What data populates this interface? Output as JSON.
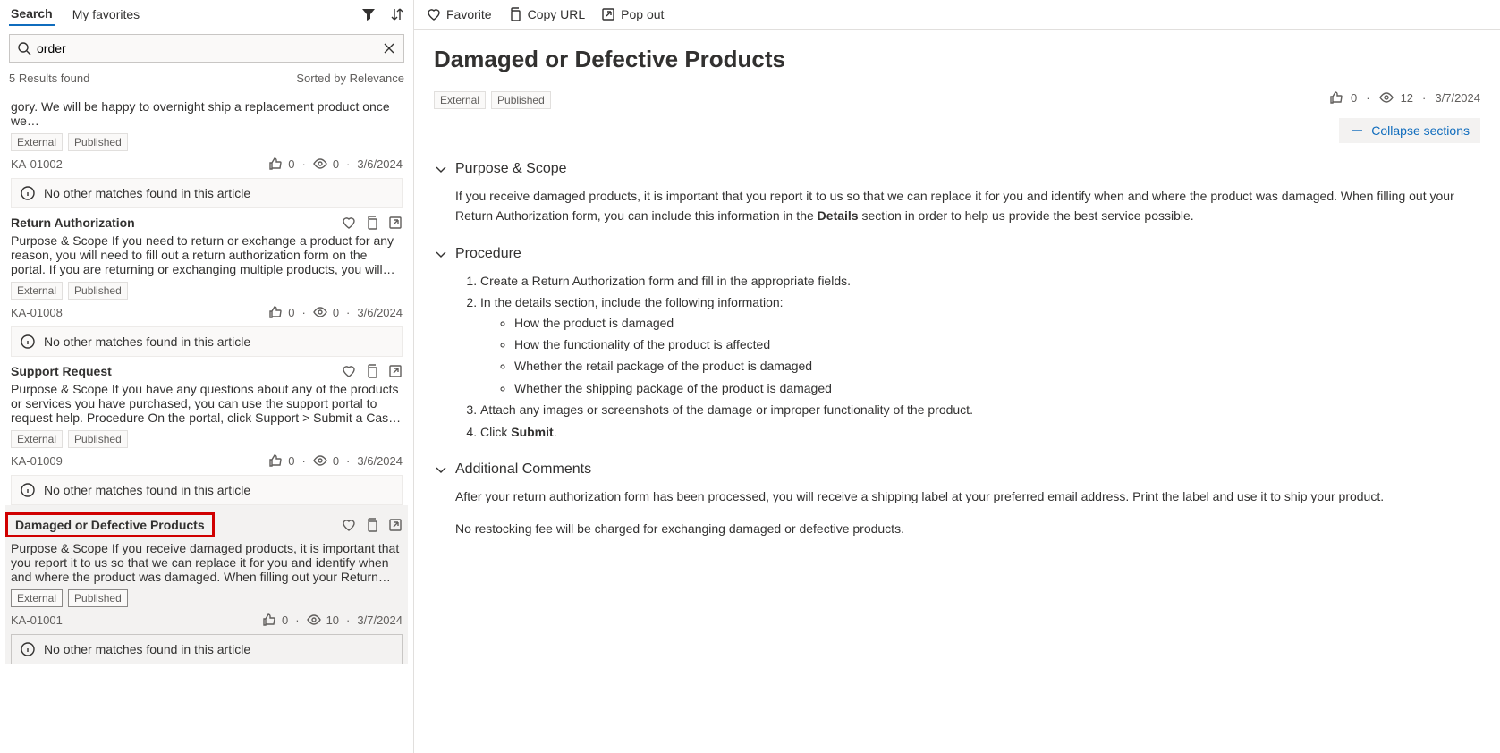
{
  "leftPanel": {
    "tabs": {
      "search": "Search",
      "favorites": "My favorites"
    },
    "searchValue": "order",
    "resultsCountText": "5 Results found",
    "sortedByText": "Sorted by Relevance",
    "results": [
      {
        "title": "",
        "snippet": "gory. We will be happy to overnight ship a replacement product once we…",
        "badges": [
          "External",
          "Published"
        ],
        "id": "KA-01002",
        "likes": "0",
        "views": "0",
        "date": "3/6/2024",
        "noMatch": "No other matches found in this article",
        "selected": false,
        "highlighted": false,
        "showTitle": false
      },
      {
        "title": "Return Authorization",
        "snippet": "Purpose & Scope If you need to return or exchange a product for any reason, you will need to fill out a return authorization form on the portal. If you are returning or exchanging multiple products, you will need to fill out…",
        "badges": [
          "External",
          "Published"
        ],
        "id": "KA-01008",
        "likes": "0",
        "views": "0",
        "date": "3/6/2024",
        "noMatch": "No other matches found in this article",
        "selected": false,
        "highlighted": false,
        "showTitle": true
      },
      {
        "title": "Support Request",
        "snippet": "Purpose & Scope If you have any questions about any of the products or services you have purchased, you can use the support portal to request help. Procedure On the portal, click Support > Submit a Case. Fill in your n…",
        "badges": [
          "External",
          "Published"
        ],
        "id": "KA-01009",
        "likes": "0",
        "views": "0",
        "date": "3/6/2024",
        "noMatch": "No other matches found in this article",
        "selected": false,
        "highlighted": false,
        "showTitle": true
      },
      {
        "title": "Damaged or Defective Products",
        "snippet": "Purpose & Scope If you receive damaged products, it is important that you report it to us so that we can replace it for you and identify when and where the product was damaged. When filling out your Return Authorizat…",
        "badges": [
          "External",
          "Published"
        ],
        "id": "KA-01001",
        "likes": "0",
        "views": "10",
        "date": "3/7/2024",
        "noMatch": "No other matches found in this article",
        "selected": true,
        "highlighted": true,
        "showTitle": true
      }
    ]
  },
  "topActions": {
    "favorite": "Favorite",
    "copyUrl": "Copy URL",
    "popOut": "Pop out"
  },
  "article": {
    "title": "Damaged or Defective Products",
    "badges": [
      "External",
      "Published"
    ],
    "likes": "0",
    "views": "12",
    "date": "3/7/2024",
    "collapseLabel": "Collapse sections",
    "sections": [
      {
        "heading": "Purpose & Scope",
        "bodyHtml": "If you receive damaged products, it is important that you report it to us so that we can replace it for you and identify when and where the product was damaged. When filling out your Return Authorization form, you can include this information in the <b>Details</b> section in order to help us provide the best service possible."
      },
      {
        "heading": "Procedure",
        "bodyHtml": "<ol><li>Create a Return Authorization form and fill in the appropriate fields.</li><li>In the details section, include the following information:<ul><li>How the product is damaged</li><li>How the functionality of the product is affected</li><li>Whether the retail package of the product is damaged</li><li>Whether the shipping package of the product is damaged</li></ul></li><li>Attach any images or screenshots of the damage or improper functionality of the product.</li><li>Click <b>Submit</b>.</li></ol>"
      },
      {
        "heading": "Additional Comments",
        "bodyHtml": "<p>After your return authorization form has been processed, you will receive a shipping label at your preferred email address. Print the label and use it to ship your product.</p><p style='margin-top:14px'>No restocking fee will be charged for exchanging damaged or defective products.</p>"
      }
    ]
  }
}
